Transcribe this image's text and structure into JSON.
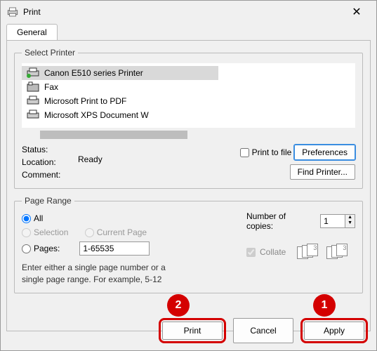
{
  "title": "Print",
  "tabs": {
    "general": "General"
  },
  "select_printer": {
    "legend": "Select Printer",
    "items": [
      {
        "name": "Canon E510 series Printer",
        "selected": true
      },
      {
        "name": "Fax",
        "selected": false
      },
      {
        "name": "Microsoft Print to PDF",
        "selected": false
      },
      {
        "name": "Microsoft XPS Document W",
        "selected": false
      }
    ]
  },
  "status": {
    "status_label": "Status:",
    "status_value": "Ready",
    "location_label": "Location:",
    "location_value": "",
    "comment_label": "Comment:",
    "comment_value": "",
    "print_to_file": "Print to file",
    "preferences": "Preferences",
    "find_printer": "Find Printer..."
  },
  "page_range": {
    "legend": "Page Range",
    "all": "All",
    "selection": "Selection",
    "current_page": "Current Page",
    "pages_label": "Pages:",
    "pages_value": "1-65535",
    "hint": "Enter either a single page number or a single page range.  For example, 5-12"
  },
  "copies": {
    "label": "Number of copies:",
    "value": "1",
    "collate": "Collate"
  },
  "buttons": {
    "print": "Print",
    "cancel": "Cancel",
    "apply": "Apply"
  },
  "callouts": {
    "one": "1",
    "two": "2"
  }
}
